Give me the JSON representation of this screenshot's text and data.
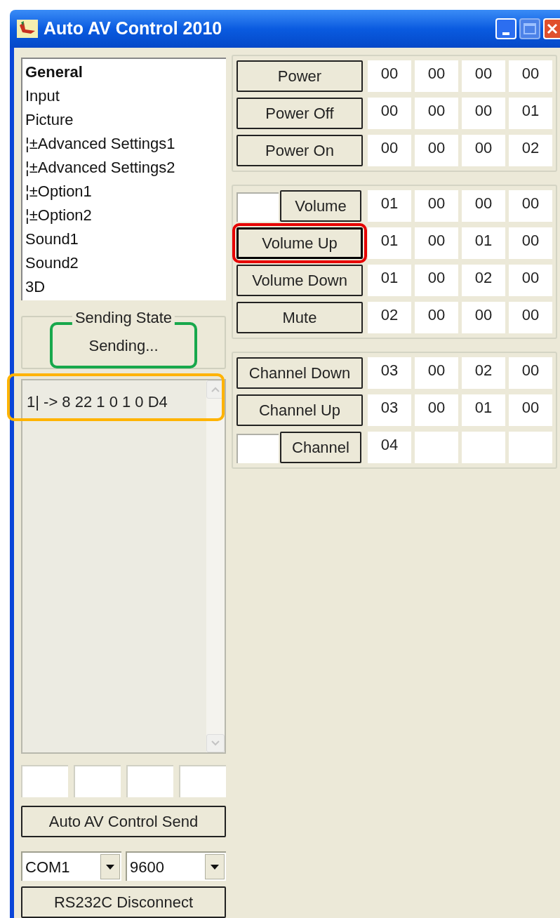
{
  "window": {
    "title": "Auto AV Control 2010"
  },
  "tree": {
    "items": [
      {
        "label": "General",
        "selected": true
      },
      {
        "label": "Input",
        "selected": false
      },
      {
        "label": "Picture",
        "selected": false
      },
      {
        "label": "¦±Advanced Settings1",
        "selected": false
      },
      {
        "label": "¦±Advanced Settings2",
        "selected": false
      },
      {
        "label": "¦±Option1",
        "selected": false
      },
      {
        "label": "¦±Option2",
        "selected": false
      },
      {
        "label": "Sound1",
        "selected": false
      },
      {
        "label": "Sound2",
        "selected": false
      },
      {
        "label": "3D",
        "selected": false
      }
    ]
  },
  "sending_state": {
    "title": "Sending State",
    "status": "Sending...",
    "highlighted": true
  },
  "log": {
    "lines": [
      "1| -> 8 22 1 0 1 0 D4"
    ],
    "highlighted": true
  },
  "send_button": "Auto AV Control Send",
  "port": {
    "value": "COM1"
  },
  "baud": {
    "value": "9600"
  },
  "disconnect_button": "RS232C Disconnect",
  "command_groups": [
    {
      "rows": [
        {
          "kind": "button",
          "label": "Power",
          "focused": false,
          "bytes": [
            "00",
            "00",
            "00",
            "00"
          ]
        },
        {
          "kind": "button",
          "label": "Power Off",
          "focused": false,
          "bytes": [
            "00",
            "00",
            "00",
            "01"
          ]
        },
        {
          "kind": "button",
          "label": "Power On",
          "focused": false,
          "bytes": [
            "00",
            "00",
            "00",
            "02"
          ]
        }
      ]
    },
    {
      "rows": [
        {
          "kind": "input_button",
          "label": "Volume",
          "focused": false,
          "bytes": [
            "01",
            "00",
            "00",
            "00"
          ]
        },
        {
          "kind": "button",
          "label": "Volume Up",
          "focused": true,
          "highlighted": true,
          "bytes": [
            "01",
            "00",
            "01",
            "00"
          ]
        },
        {
          "kind": "button",
          "label": "Volume Down",
          "focused": false,
          "bytes": [
            "01",
            "00",
            "02",
            "00"
          ]
        },
        {
          "kind": "button",
          "label": "Mute",
          "focused": false,
          "bytes": [
            "02",
            "00",
            "00",
            "00"
          ]
        }
      ]
    },
    {
      "rows": [
        {
          "kind": "button",
          "label": "Channel Down",
          "focused": false,
          "bytes": [
            "03",
            "00",
            "02",
            "00"
          ]
        },
        {
          "kind": "button",
          "label": "Channel Up",
          "focused": false,
          "bytes": [
            "03",
            "00",
            "01",
            "00"
          ]
        },
        {
          "kind": "input_button",
          "label": "Channel",
          "focused": false,
          "bytes": [
            "04"
          ]
        }
      ]
    }
  ]
}
